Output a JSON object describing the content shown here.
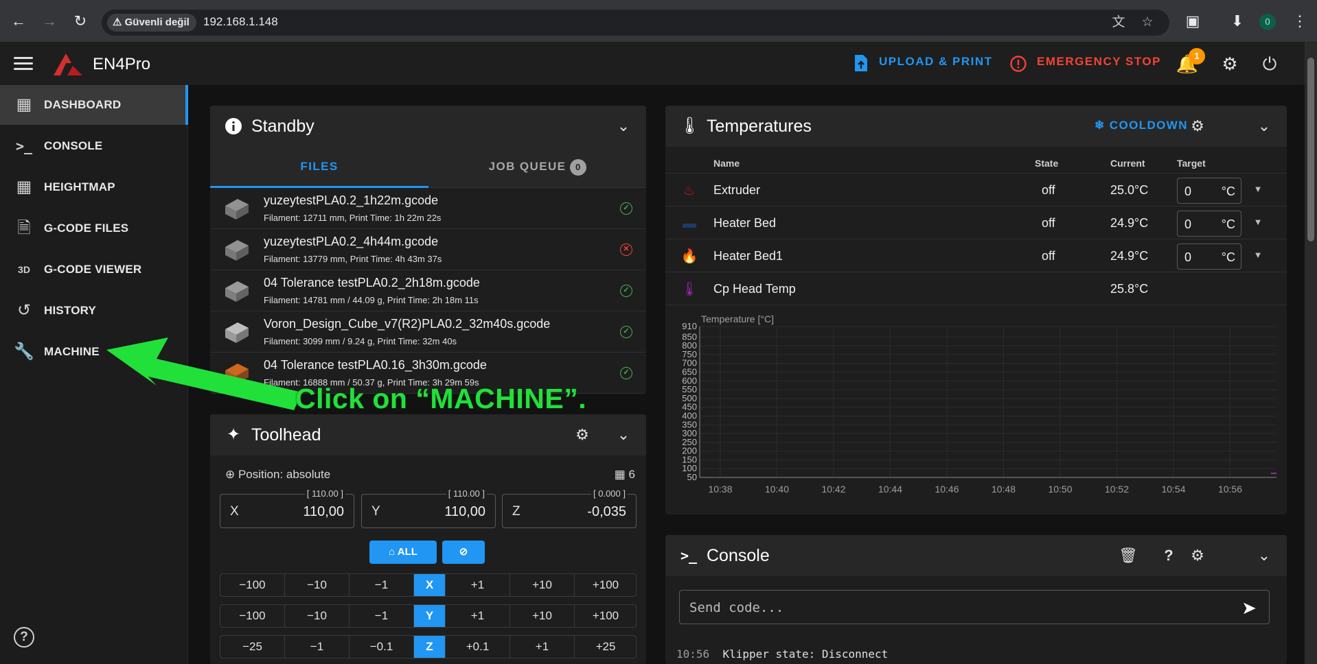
{
  "browser": {
    "security_label": "Güvenli değil",
    "url": "192.168.1.148",
    "profile_initial": "0"
  },
  "header": {
    "app_name": "EN4Pro",
    "upload_label": "UPLOAD & PRINT",
    "emergency_label": "EMERGENCY STOP",
    "notification_count": "1"
  },
  "sidebar": {
    "items": [
      {
        "label": "DASHBOARD",
        "icon": "dashboard-icon",
        "active": true
      },
      {
        "label": "CONSOLE",
        "icon": "console-icon"
      },
      {
        "label": "HEIGHTMAP",
        "icon": "grid-icon"
      },
      {
        "label": "G-CODE FILES",
        "icon": "file-document-icon"
      },
      {
        "label": "G-CODE VIEWER",
        "icon": "3d-icon",
        "glyph": "3D"
      },
      {
        "label": "HISTORY",
        "icon": "history-icon"
      },
      {
        "label": "MACHINE",
        "icon": "wrench-icon"
      }
    ]
  },
  "standby": {
    "title": "Standby",
    "tab_files": "FILES",
    "tab_queue": "JOB QUEUE",
    "queue_count": "0",
    "files": [
      {
        "name": "yuzeytestPLA0.2_1h22m.gcode",
        "meta": "Filament: 12711 mm, Print Time: 1h 22m 22s",
        "status": "ok",
        "color": "#9e9e9e"
      },
      {
        "name": "yuzeytestPLA0.2_4h44m.gcode",
        "meta": "Filament: 13779 mm, Print Time: 4h 43m 37s",
        "status": "error",
        "color": "#9e9e9e"
      },
      {
        "name": "04 Tolerance testPLA0.2_2h18m.gcode",
        "meta": "Filament: 14781 mm / 44.09 g, Print Time: 2h 18m 11s",
        "status": "ok",
        "color": "#a8a8a8"
      },
      {
        "name": "Voron_Design_Cube_v7(R2)PLA0.2_32m40s.gcode",
        "meta": "Filament: 3099 mm / 9.24 g, Print Time: 32m 40s",
        "status": "ok",
        "color": "#d0d0d0"
      },
      {
        "name": "04 Tolerance testPLA0.16_3h30m.gcode",
        "meta": "Filament: 16888 mm / 50.37 g, Print Time: 3h 29m 59s",
        "status": "ok",
        "color": "#e07020"
      }
    ]
  },
  "toolhead": {
    "title": "Toolhead",
    "position_label": "Position: absolute",
    "grid_count": "6",
    "axes": [
      {
        "name": "X",
        "value": "110,00",
        "tag": "[ 110.00 ]"
      },
      {
        "name": "Y",
        "value": "110,00",
        "tag": "[ 110.00 ]"
      },
      {
        "name": "Z",
        "value": "-0,035",
        "tag": "[ 0.000 ]"
      }
    ],
    "home_all_label": "ALL",
    "jog_rows": [
      {
        "axis": "X",
        "neg": [
          "−100",
          "−10",
          "−1"
        ],
        "pos": [
          "+1",
          "+10",
          "+100"
        ]
      },
      {
        "axis": "Y",
        "neg": [
          "−100",
          "−10",
          "−1"
        ],
        "pos": [
          "+1",
          "+10",
          "+100"
        ]
      },
      {
        "axis": "Z",
        "neg": [
          "−25",
          "−1",
          "−0.1"
        ],
        "pos": [
          "+0.1",
          "+1",
          "+25"
        ]
      }
    ]
  },
  "temperatures": {
    "title": "Temperatures",
    "cooldown_label": "COOLDOWN",
    "columns": {
      "name": "Name",
      "state": "State",
      "current": "Current",
      "target": "Target"
    },
    "rows": [
      {
        "name": "Extruder",
        "state": "off",
        "current": "25.0°C",
        "target": "0",
        "unit": "°C",
        "icon_color": "#b71c1c"
      },
      {
        "name": "Heater Bed",
        "state": "off",
        "current": "24.9°C",
        "target": "0",
        "unit": "°C",
        "icon_color": "#1e3a6a"
      },
      {
        "name": "Heater Bed1",
        "state": "off",
        "current": "24.9°C",
        "target": "0",
        "unit": "°C",
        "icon_color": "#4a2a6a"
      },
      {
        "name": "Cp Head Temp",
        "state": "",
        "current": "25.8°C",
        "target": "",
        "unit": "",
        "icon_color": "#9c27b0"
      }
    ]
  },
  "chart_data": {
    "type": "line",
    "ylabel": "Temperature [°C]",
    "y_ticks": [
      50,
      100,
      150,
      200,
      250,
      300,
      350,
      400,
      450,
      500,
      550,
      600,
      650,
      700,
      750,
      800,
      850,
      910
    ],
    "x_ticks": [
      "10:38",
      "10:40",
      "10:42",
      "10:44",
      "10:46",
      "10:48",
      "10:50",
      "10:52",
      "10:54",
      "10:56"
    ],
    "ylim": [
      50,
      910
    ],
    "grid": true,
    "series": []
  },
  "console": {
    "title": "Console",
    "placeholder": "Send code...",
    "line_time": "10:56",
    "line_text": "Klipper state: Disconnect"
  },
  "annotation": {
    "text": "Click on “MACHINE”.",
    "color": "#22e03a"
  }
}
